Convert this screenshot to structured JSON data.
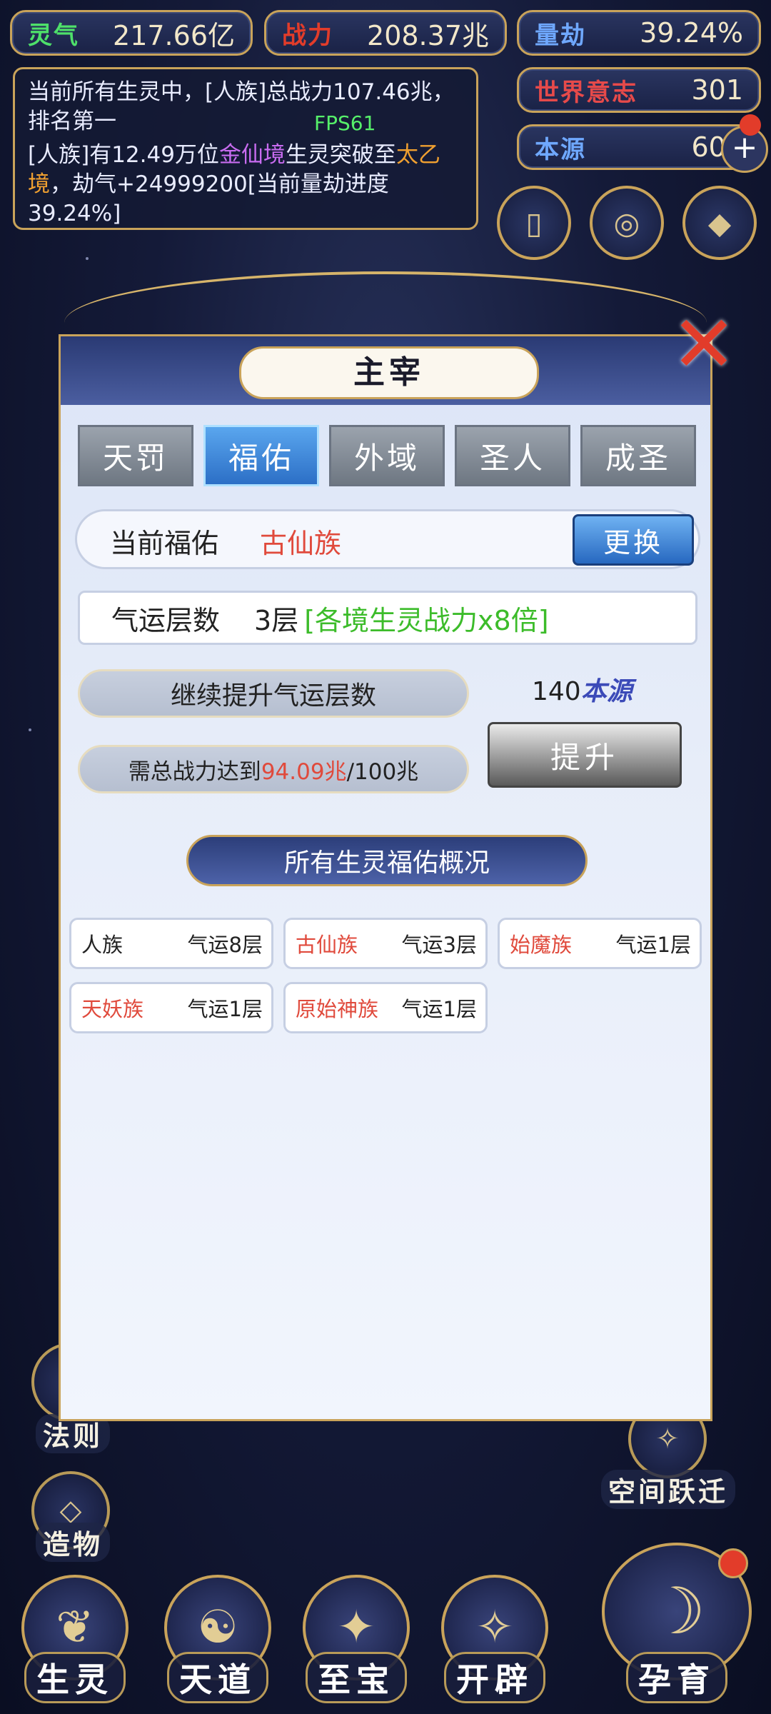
{
  "stats": {
    "lingqi": {
      "label": "灵气",
      "value": "217.66亿",
      "color": "#4ee06a"
    },
    "zhanli": {
      "label": "战力",
      "value": "208.37兆",
      "color": "#e23c2a"
    },
    "liangjie": {
      "label": "量劫",
      "value": "39.24%",
      "color": "#6fa8ff"
    },
    "shijie": {
      "label": "世界意志",
      "value": "301",
      "color": "#e64a4a"
    },
    "benyuan": {
      "label": "本源",
      "value": "609",
      "color": "#6fa8ff"
    }
  },
  "log": {
    "line1": "当前所有生灵中，[人族]总战力107.46兆，排名第一",
    "line2_a": "[人族]有12.49万位",
    "line2_realm": "金仙境",
    "line2_b": "生灵突破至",
    "line2_realm2": "太乙境",
    "line2_c": "，劫气+24999200[当前量劫进度39.24%]"
  },
  "fps": "FPS61",
  "top_buttons": [
    {
      "icon": "scroll-icon",
      "glyph": "▯"
    },
    {
      "icon": "vortex-icon",
      "glyph": "◎"
    },
    {
      "icon": "fan-icon",
      "glyph": "◆"
    }
  ],
  "side_left": [
    {
      "label": "法则"
    },
    {
      "label": "造物"
    }
  ],
  "side_right": [
    {
      "label": "空间跃迁"
    }
  ],
  "bottom_nav": [
    {
      "label": "生灵",
      "icon": "creature-icon",
      "glyph": "❦"
    },
    {
      "label": "天道",
      "icon": "heaven-icon",
      "glyph": "☯"
    },
    {
      "label": "至宝",
      "icon": "treasure-icon",
      "glyph": "✦"
    },
    {
      "label": "开辟",
      "icon": "creation-icon",
      "glyph": "✧"
    },
    {
      "label": "孕育",
      "icon": "nurture-icon",
      "glyph": "☽"
    }
  ],
  "panel": {
    "title": "主宰",
    "tabs": [
      "天罚",
      "福佑",
      "外域",
      "圣人",
      "成圣"
    ],
    "active_tab": 1,
    "blessing": {
      "label": "当前福佑",
      "value": "古仙族",
      "button": "更换"
    },
    "luck": {
      "label": "气运层数",
      "layers": "3层",
      "effect": "[各境生灵战力x8倍]"
    },
    "upgrade": {
      "title": "继续提升气运层数",
      "requirement_prefix": "需总战力达到",
      "requirement_current": "94.09兆",
      "requirement_target": "/100兆",
      "cost_amount": "140",
      "cost_unit": "本源",
      "button": "提升"
    },
    "overview_title": "所有生灵福佑概况",
    "races": [
      {
        "name": "人族",
        "luck": "气运8层",
        "highlight": false
      },
      {
        "name": "古仙族",
        "luck": "气运3层",
        "highlight": true
      },
      {
        "name": "始魔族",
        "luck": "气运1层",
        "highlight": true
      },
      {
        "name": "天妖族",
        "luck": "气运1层",
        "highlight": true
      },
      {
        "name": "原始神族",
        "luck": "气运1层",
        "highlight": true
      }
    ]
  }
}
